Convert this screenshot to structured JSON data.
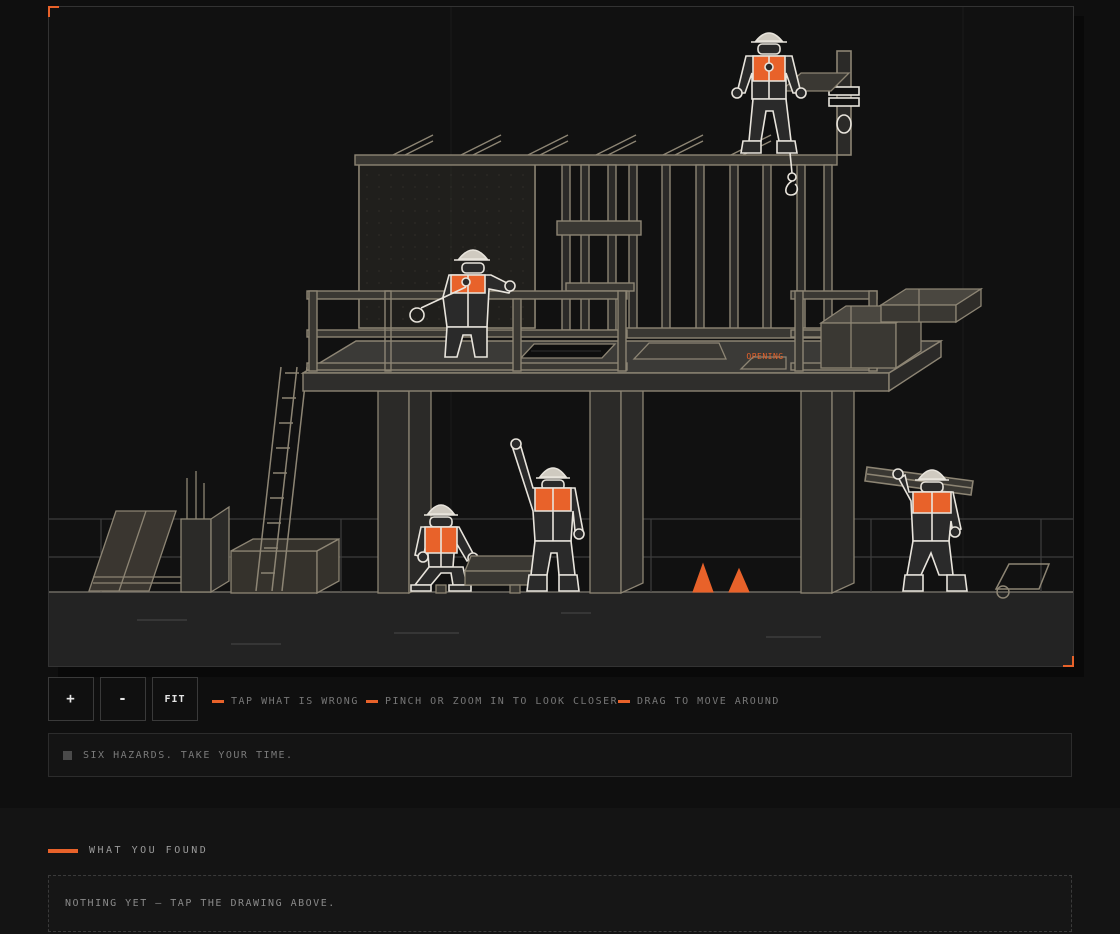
{
  "scene": {
    "opening_label": "OPENING",
    "colors": {
      "accent": "#e8622a",
      "line": "#8d8574",
      "bright_line": "#e8e4dc",
      "dark_fill": "#2b2a28"
    }
  },
  "controls": {
    "zoom_in": "+",
    "zoom_out": "-",
    "fit": "FIT"
  },
  "hints": [
    "TAP WHAT IS WRONG",
    "PINCH OR ZOOM IN TO LOOK CLOSER",
    "DRAG TO MOVE AROUND"
  ],
  "status": {
    "text": "SIX HAZARDS. TAKE YOUR TIME."
  },
  "found": {
    "heading": "WHAT YOU FOUND",
    "empty_text": "NOTHING YET — TAP THE DRAWING ABOVE."
  }
}
